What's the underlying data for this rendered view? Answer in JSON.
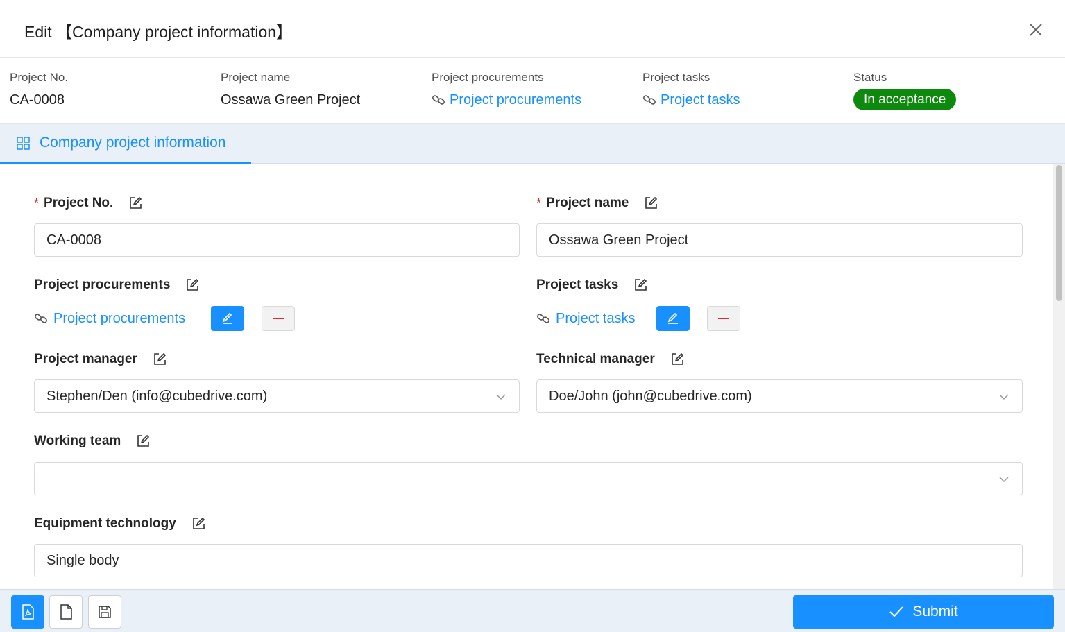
{
  "dialog": {
    "title": "Edit 【Company project information】"
  },
  "summary": {
    "project_no": {
      "label": "Project No.",
      "value": "CA-0008"
    },
    "project_name": {
      "label": "Project name",
      "value": "Ossawa Green Project"
    },
    "project_procurements": {
      "label": "Project procurements",
      "value": "Project procurements"
    },
    "project_tasks": {
      "label": "Project tasks",
      "value": "Project tasks"
    },
    "status": {
      "label": "Status",
      "value": "In acceptance",
      "color": "#0d8a0d"
    }
  },
  "tabs": [
    {
      "label": "Company project information",
      "active": true
    }
  ],
  "form": {
    "project_no": {
      "label": "Project No.",
      "required": true,
      "value": "CA-0008"
    },
    "project_name": {
      "label": "Project name",
      "required": true,
      "value": "Ossawa Green Project"
    },
    "project_procurements": {
      "label": "Project procurements",
      "link": "Project procurements"
    },
    "project_tasks": {
      "label": "Project tasks",
      "link": "Project tasks"
    },
    "project_manager": {
      "label": "Project manager",
      "value": "Stephen/Den (info@cubedrive.com)"
    },
    "technical_manager": {
      "label": "Technical manager",
      "value": "Doe/John (john@cubedrive.com)"
    },
    "working_team": {
      "label": "Working team",
      "value": ""
    },
    "equipment_technology": {
      "label": "Equipment technology",
      "value": "Single body"
    }
  },
  "footer": {
    "icons": [
      "pdf-file-icon",
      "file-icon",
      "save-icon"
    ],
    "submit_label": "Submit"
  },
  "colors": {
    "accent": "#1890ff",
    "required": "#e0282e",
    "status_green": "#0d8a0d",
    "tabbar_bg": "#eaf0f8"
  }
}
